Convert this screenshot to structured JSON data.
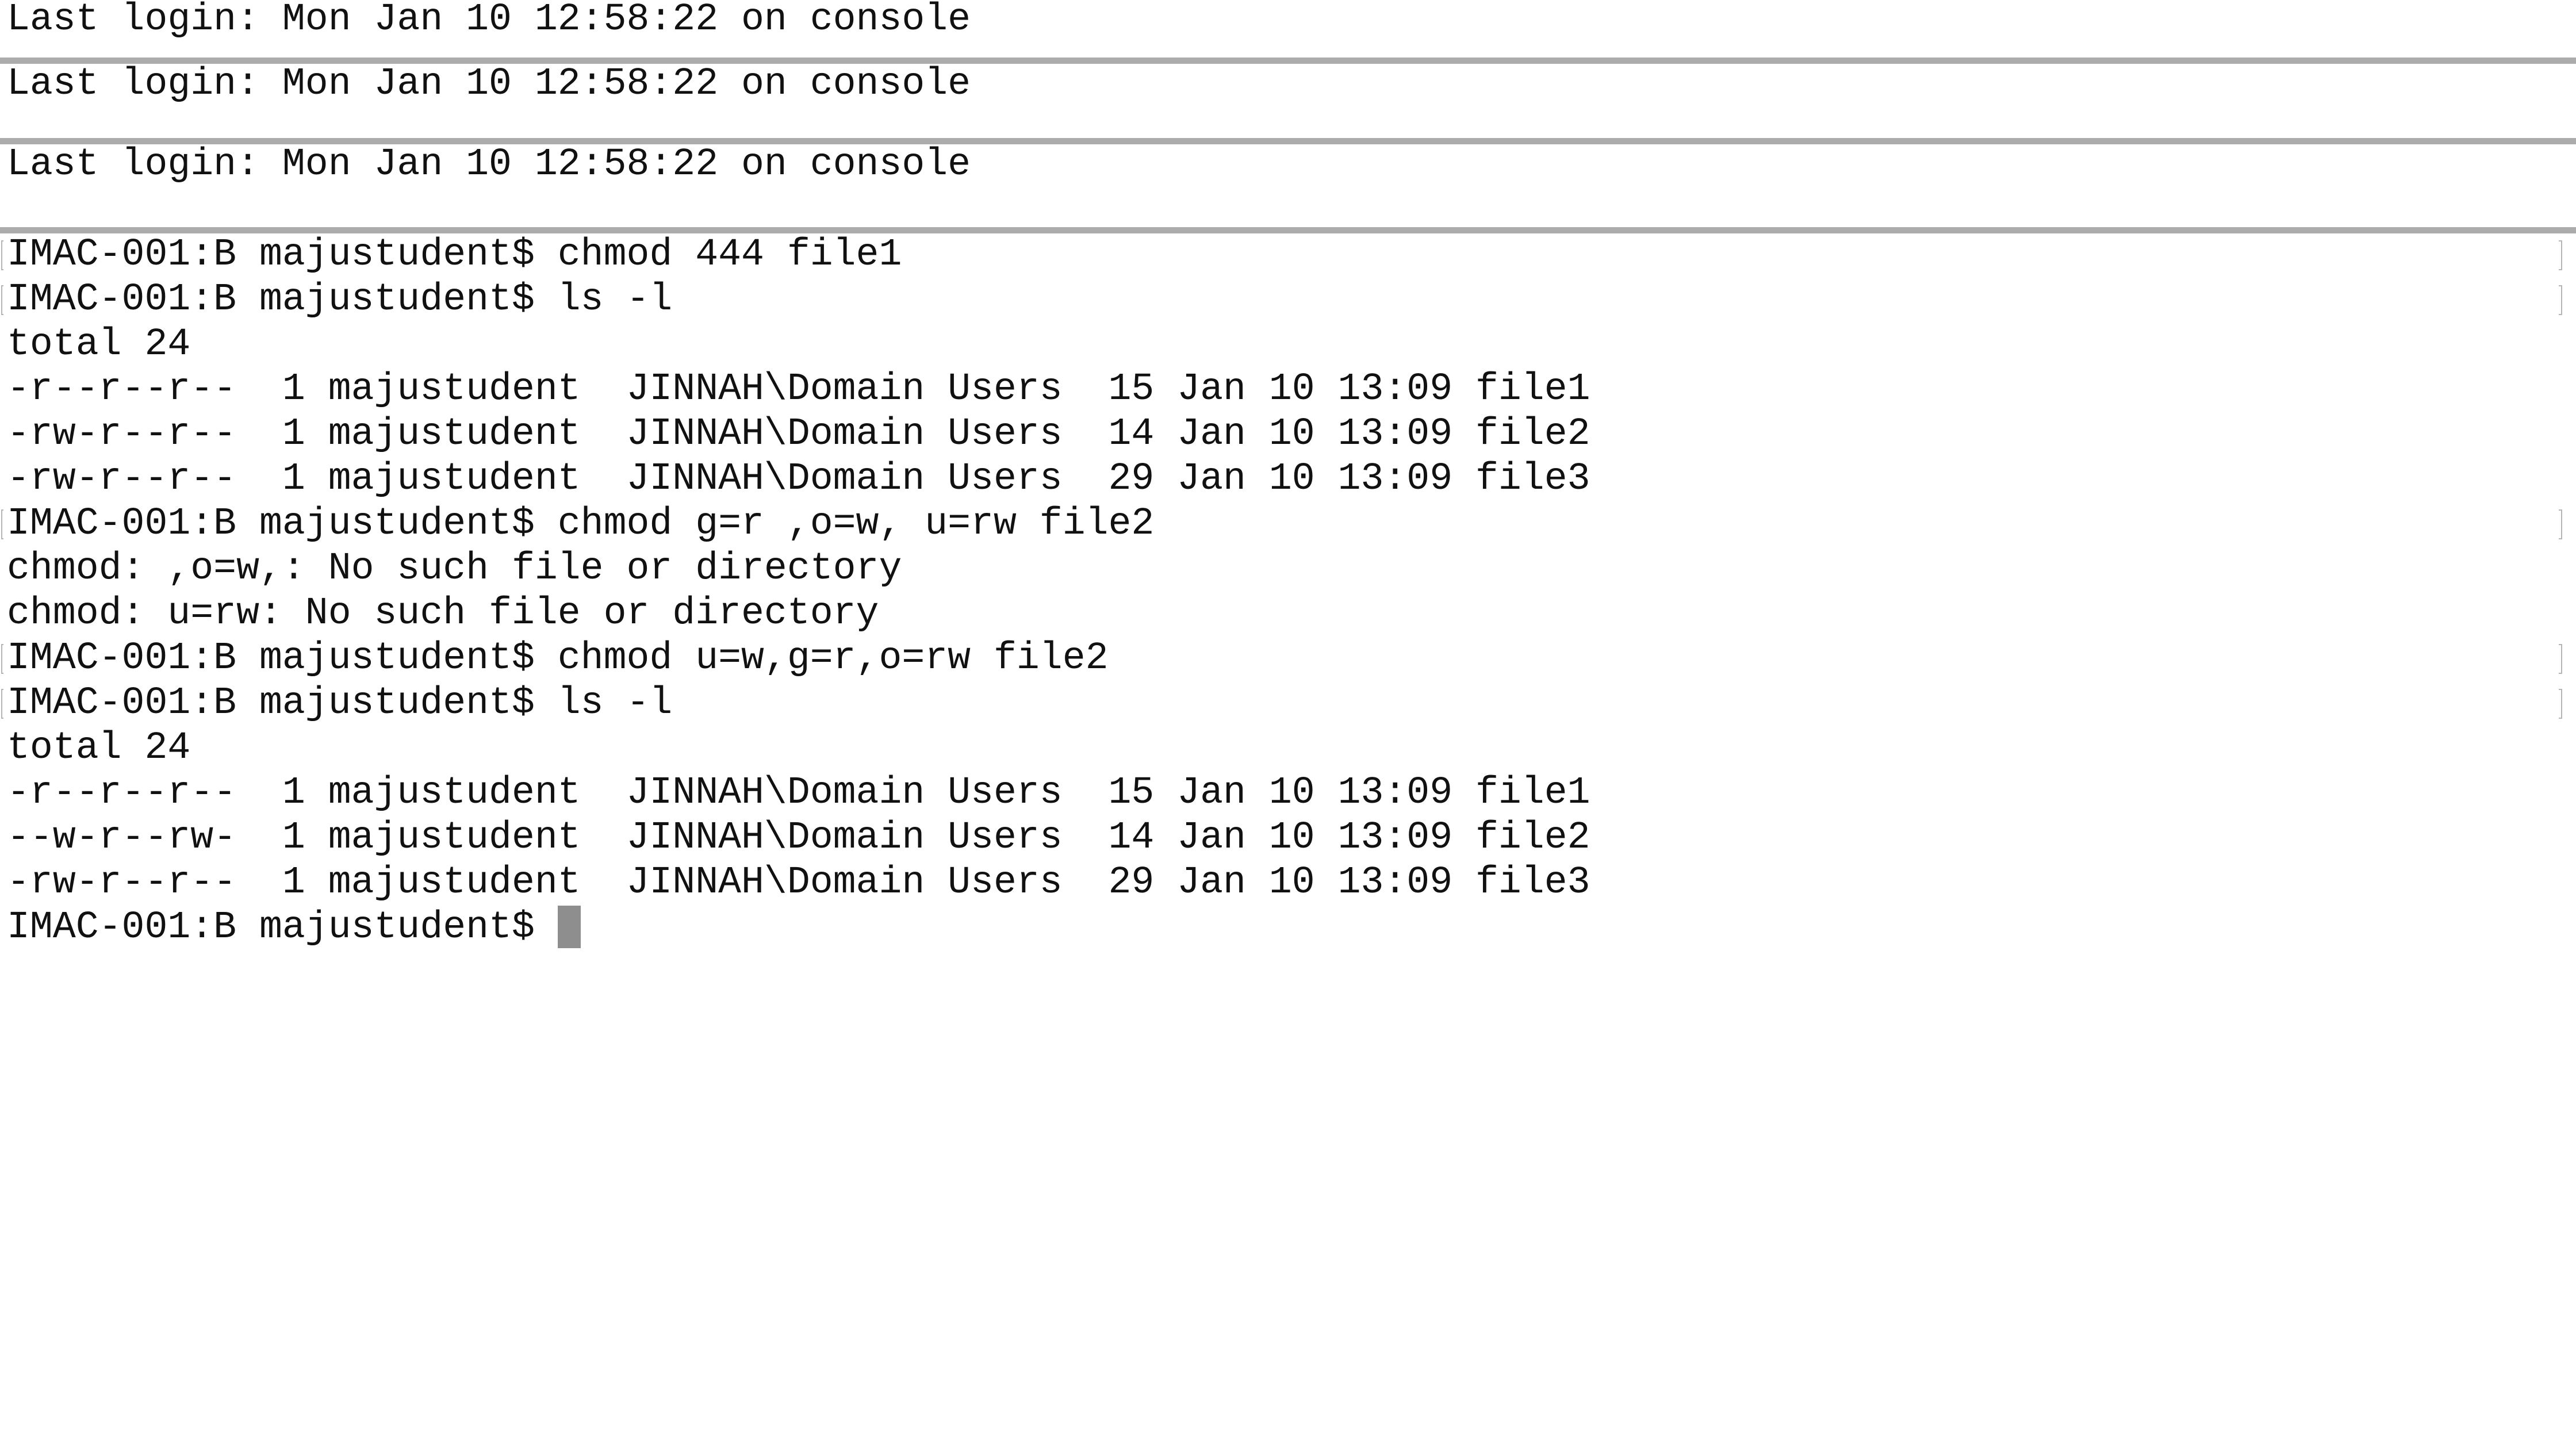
{
  "panes": [
    {
      "lines": [
        "Last login: Mon Jan 10 12:58:22 on console"
      ]
    },
    {
      "lines": [
        "Last login: Mon Jan 10 12:58:22 on console"
      ]
    },
    {
      "lines": [
        "Last login: Mon Jan 10 12:58:22 on console"
      ]
    }
  ],
  "main": {
    "lines": [
      {
        "text": "IMAC-001:B majustudent$ chmod 444 file1",
        "prompt": true
      },
      {
        "text": "IMAC-001:B majustudent$ ls -l",
        "prompt": true
      },
      {
        "text": "total 24",
        "prompt": false
      },
      {
        "text": "-r--r--r--  1 majustudent  JINNAH\\Domain Users  15 Jan 10 13:09 file1",
        "prompt": false
      },
      {
        "text": "-rw-r--r--  1 majustudent  JINNAH\\Domain Users  14 Jan 10 13:09 file2",
        "prompt": false
      },
      {
        "text": "-rw-r--r--  1 majustudent  JINNAH\\Domain Users  29 Jan 10 13:09 file3",
        "prompt": false
      },
      {
        "text": "IMAC-001:B majustudent$ chmod g=r ,o=w, u=rw file2",
        "prompt": true
      },
      {
        "text": "chmod: ,o=w,: No such file or directory",
        "prompt": false
      },
      {
        "text": "chmod: u=rw: No such file or directory",
        "prompt": false
      },
      {
        "text": "IMAC-001:B majustudent$ chmod u=w,g=r,o=rw file2",
        "prompt": true
      },
      {
        "text": "IMAC-001:B majustudent$ ls -l",
        "prompt": true
      },
      {
        "text": "total 24",
        "prompt": false
      },
      {
        "text": "-r--r--r--  1 majustudent  JINNAH\\Domain Users  15 Jan 10 13:09 file1",
        "prompt": false
      },
      {
        "text": "--w-r--rw-  1 majustudent  JINNAH\\Domain Users  14 Jan 10 13:09 file2",
        "prompt": false
      },
      {
        "text": "-rw-r--r--  1 majustudent  JINNAH\\Domain Users  29 Jan 10 13:09 file3",
        "prompt": false
      }
    ],
    "current_prompt": "IMAC-001:B majustudent$ "
  }
}
